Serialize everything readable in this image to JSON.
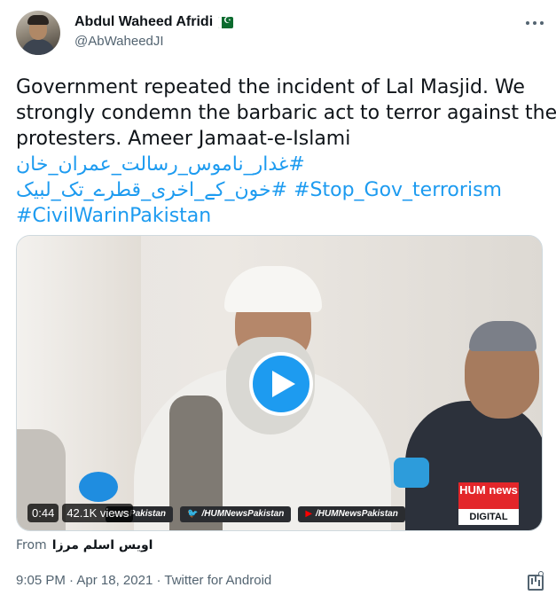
{
  "author": {
    "name": "Abdul Waheed Afridi",
    "handle": "@AbWaheedJI",
    "flag_icon": "pakistan-flag-icon"
  },
  "tweet": {
    "text_line_1": "Government repeated the incident of Lal Masjid. We",
    "text_line_2": "strongly condemn the barbaric act to terror against the",
    "text_line_3": "protesters. Ameer Jamaat-e-Islami",
    "hashtag_1": "#غدار_ناموس_رسالت_عمران_خان",
    "hashtag_2": "#خون_کے_اخری_قطرے_تک_لبیک",
    "hashtag_3": "#Stop_Gov_terrorism",
    "hashtag_4": "#CivilWarinPakistan"
  },
  "media": {
    "duration": "0:44",
    "views": "42.1K views",
    "strip_tag_1": "ewsPakistan",
    "strip_tag_2": "/HUMNewsPakistan",
    "strip_tag_3": "/HUMNewsPakistan",
    "channel_logo_top": "HUM news",
    "channel_logo_bottom": "DIGITAL"
  },
  "from": {
    "label": "From",
    "user": "اویس اسلم مرزا"
  },
  "meta": {
    "time": "9:05 PM",
    "separator_1": " · ",
    "date": "Apr 18, 2021",
    "separator_2": " · ",
    "source": "Twitter for Android"
  },
  "colors": {
    "link": "#1d9bf0",
    "secondary_text": "#536471",
    "primary_text": "#0f1419"
  }
}
